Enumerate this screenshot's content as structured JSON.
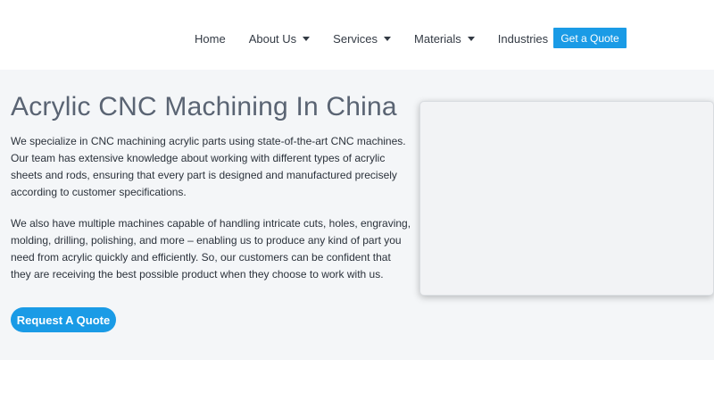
{
  "nav": {
    "items": [
      {
        "label": "Home",
        "has_dropdown": false
      },
      {
        "label": "About Us",
        "has_dropdown": true
      },
      {
        "label": "Services",
        "has_dropdown": true
      },
      {
        "label": "Materials",
        "has_dropdown": true
      },
      {
        "label": "Industries",
        "has_dropdown": true
      }
    ],
    "cta_label": "Get a Quote"
  },
  "hero": {
    "title": "Acrylic CNC Machining In China",
    "paragraph_1": "We specialize in CNC machining acrylic parts using state-of-the-art CNC machines. Our team has extensive knowledge about working with different types of acrylic sheets and rods, ensuring that every part is designed and manufactured precisely according to customer specifications.",
    "paragraph_2": "We also have multiple machines capable of handling intricate cuts, holes, engraving, molding, drilling, polishing, and more – enabling us to produce any kind of part you need from acrylic quickly and efficiently. So, our customers can be confident that they are receiving the best possible product when they choose to work with us.",
    "button_label": "Request A Quote"
  },
  "colors": {
    "accent": "#1a9be6",
    "hero_bg": "#f4f6f8",
    "text": "#2b323b",
    "title": "#5a6473"
  },
  "icons": {
    "dropdown": "caret-down-icon"
  }
}
